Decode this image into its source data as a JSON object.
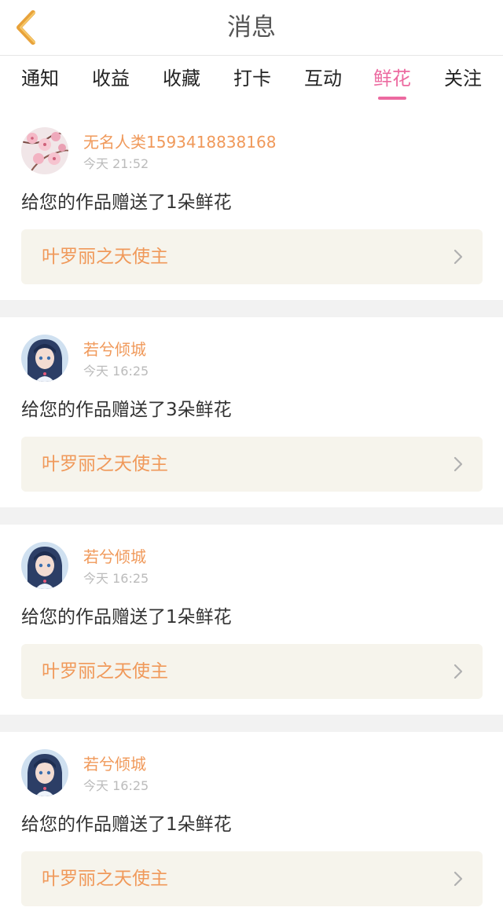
{
  "header": {
    "title": "消息",
    "back_icon": "chevron-left-icon",
    "back_color": "#e8a23a"
  },
  "tabs": [
    {
      "label": "通知",
      "active": false
    },
    {
      "label": "收益",
      "active": false
    },
    {
      "label": "收藏",
      "active": false
    },
    {
      "label": "打卡",
      "active": false
    },
    {
      "label": "互动",
      "active": false
    },
    {
      "label": "鲜花",
      "active": true
    },
    {
      "label": "关注",
      "active": false
    }
  ],
  "colors": {
    "accent_pink": "#ec6aa0",
    "username_orange": "#f0995a",
    "card_bg": "#f6f4ec",
    "separator": "#f2f2f2"
  },
  "notifications": [
    {
      "username": "无名人类1593418838168",
      "time": "今天 21:52",
      "message": "给您的作品赠送了1朵鲜花",
      "work_title": "叶罗丽之天使主",
      "avatar": "cherry-blossom-avatar"
    },
    {
      "username": "若兮倾城",
      "time": "今天 16:25",
      "message": "给您的作品赠送了3朵鲜花",
      "work_title": "叶罗丽之天使主",
      "avatar": "anime-girl-avatar"
    },
    {
      "username": "若兮倾城",
      "time": "今天 16:25",
      "message": "给您的作品赠送了1朵鲜花",
      "work_title": "叶罗丽之天使主",
      "avatar": "anime-girl-avatar"
    },
    {
      "username": "若兮倾城",
      "time": "今天 16:25",
      "message": "给您的作品赠送了1朵鲜花",
      "work_title": "叶罗丽之天使主",
      "avatar": "anime-girl-avatar"
    }
  ]
}
